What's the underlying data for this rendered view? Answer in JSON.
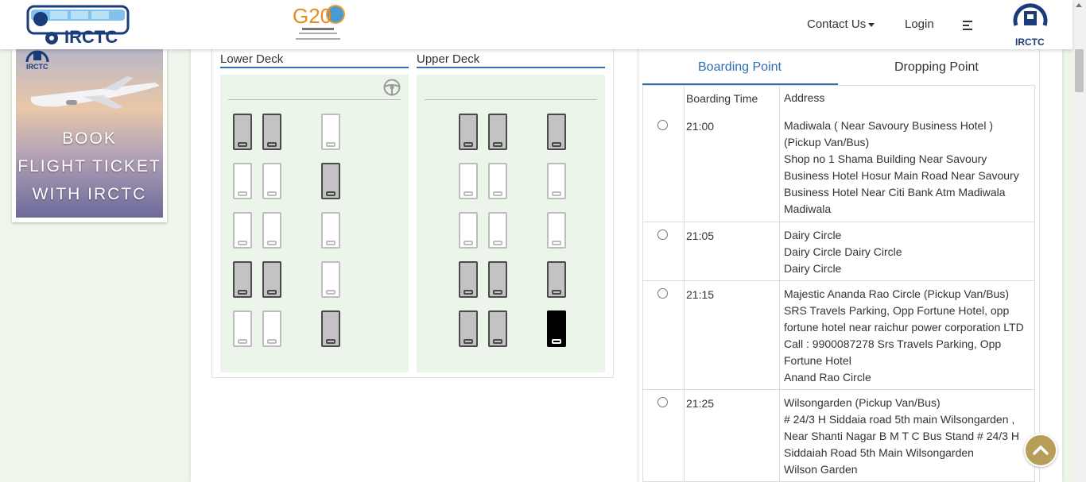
{
  "header": {
    "brand": "IRCTC",
    "g20_logo": "G20",
    "nav": {
      "contact": "Contact Us",
      "login": "Login"
    },
    "right_logo_text": "IRCTC"
  },
  "ad": {
    "logo_text": "IRCTC",
    "lines": [
      "BOOK",
      "FLIGHT TICKET",
      "WITH IRCTC"
    ]
  },
  "decks": {
    "lower": {
      "title": "Lower Deck"
    },
    "upper": {
      "title": "Upper Deck"
    }
  },
  "seat_layout": {
    "lower": [
      [
        "booked",
        "booked",
        "avail"
      ],
      [
        "avail",
        "avail",
        "booked"
      ],
      [
        "avail",
        "avail",
        "avail"
      ],
      [
        "booked",
        "booked",
        "avail"
      ],
      [
        "avail",
        "avail",
        "booked"
      ]
    ],
    "upper": [
      [
        "booked",
        "booked",
        "booked"
      ],
      [
        "avail",
        "avail",
        "avail"
      ],
      [
        "avail",
        "avail",
        "avail"
      ],
      [
        "booked",
        "booked",
        "booked"
      ],
      [
        "booked",
        "booked",
        "selected"
      ]
    ]
  },
  "tabs": {
    "boarding": "Boarding Point",
    "dropping": "Dropping Point"
  },
  "table": {
    "headers": {
      "time": "Boarding Time",
      "address": "Address"
    },
    "rows": [
      {
        "time": "21:00",
        "lines": [
          "Madiwala ( Near Savoury Business Hotel )",
          "(Pickup Van/Bus)",
          "Shop no 1 Shama Building Near Savoury",
          "Business Hotel Hosur Main Road Near Savoury",
          "Business Hotel Near Citi Bank Atm Madiwala",
          "Madiwala"
        ]
      },
      {
        "time": "21:05",
        "lines": [
          "Dairy Circle",
          "Dairy Circle Dairy Circle",
          "Dairy Circle"
        ]
      },
      {
        "time": "21:15",
        "lines": [
          "Majestic Ananda Rao Circle (Pickup Van/Bus)",
          "SRS Travels Parking, Opp Fortune Hotel, opp",
          "fortune hotel near raichur power corporation LTD",
          "Call : 9900087278 Srs Travels Parking, Opp",
          "Fortune Hotel",
          "Anand Rao Circle"
        ]
      },
      {
        "time": "21:25",
        "lines": [
          "Wilsongarden (Pickup Van/Bus)",
          "# 24/3 H Siddaia road 5th main Wilsongarden ,",
          "Near Shanti Nagar B M T C Bus Stand # 24/3 H",
          "Siddaiah Road 5th Main Wilsongarden",
          "Wilson Garden"
        ]
      }
    ]
  },
  "colors": {
    "accent": "#2f6fb3",
    "booked": "#c3c3c3",
    "selected": "#000000",
    "deck_bg": "#ecf5ea",
    "to_top": "#b79e58"
  }
}
